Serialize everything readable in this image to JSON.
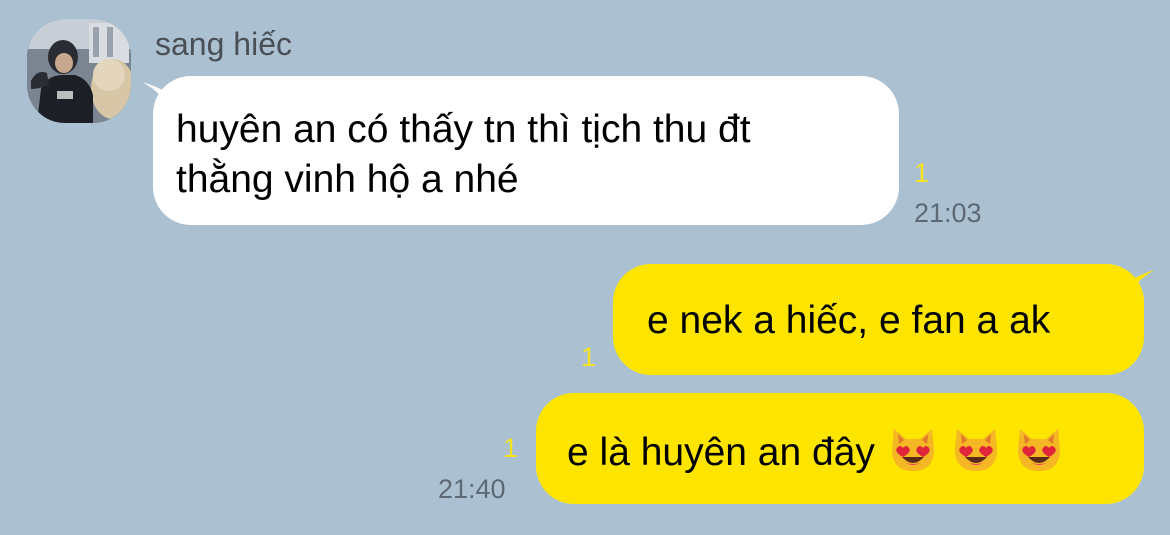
{
  "incoming": {
    "sender_name": "sang hiếc",
    "lines": [
      "huyên an có thấy tn thì tịch thu đt",
      "thằng vinh hộ a nhé"
    ],
    "unread": "1",
    "time": "21:03"
  },
  "outgoing": [
    {
      "text": "e nek a hiếc, e fan a ak",
      "unread": "1"
    },
    {
      "text": "e là huyên an đây",
      "emoji": [
        "smiling-cat-heart-eyes",
        "smiling-cat-heart-eyes",
        "smiling-cat-heart-eyes"
      ],
      "unread": "1",
      "time": "21:40"
    }
  ],
  "colors": {
    "background": "#abc1d1",
    "incoming_bubble": "#ffffff",
    "outgoing_bubble": "#fee500",
    "unread_count": "#f5e31f",
    "timestamp": "#5d6a76",
    "sender_name": "#4a4f55"
  }
}
